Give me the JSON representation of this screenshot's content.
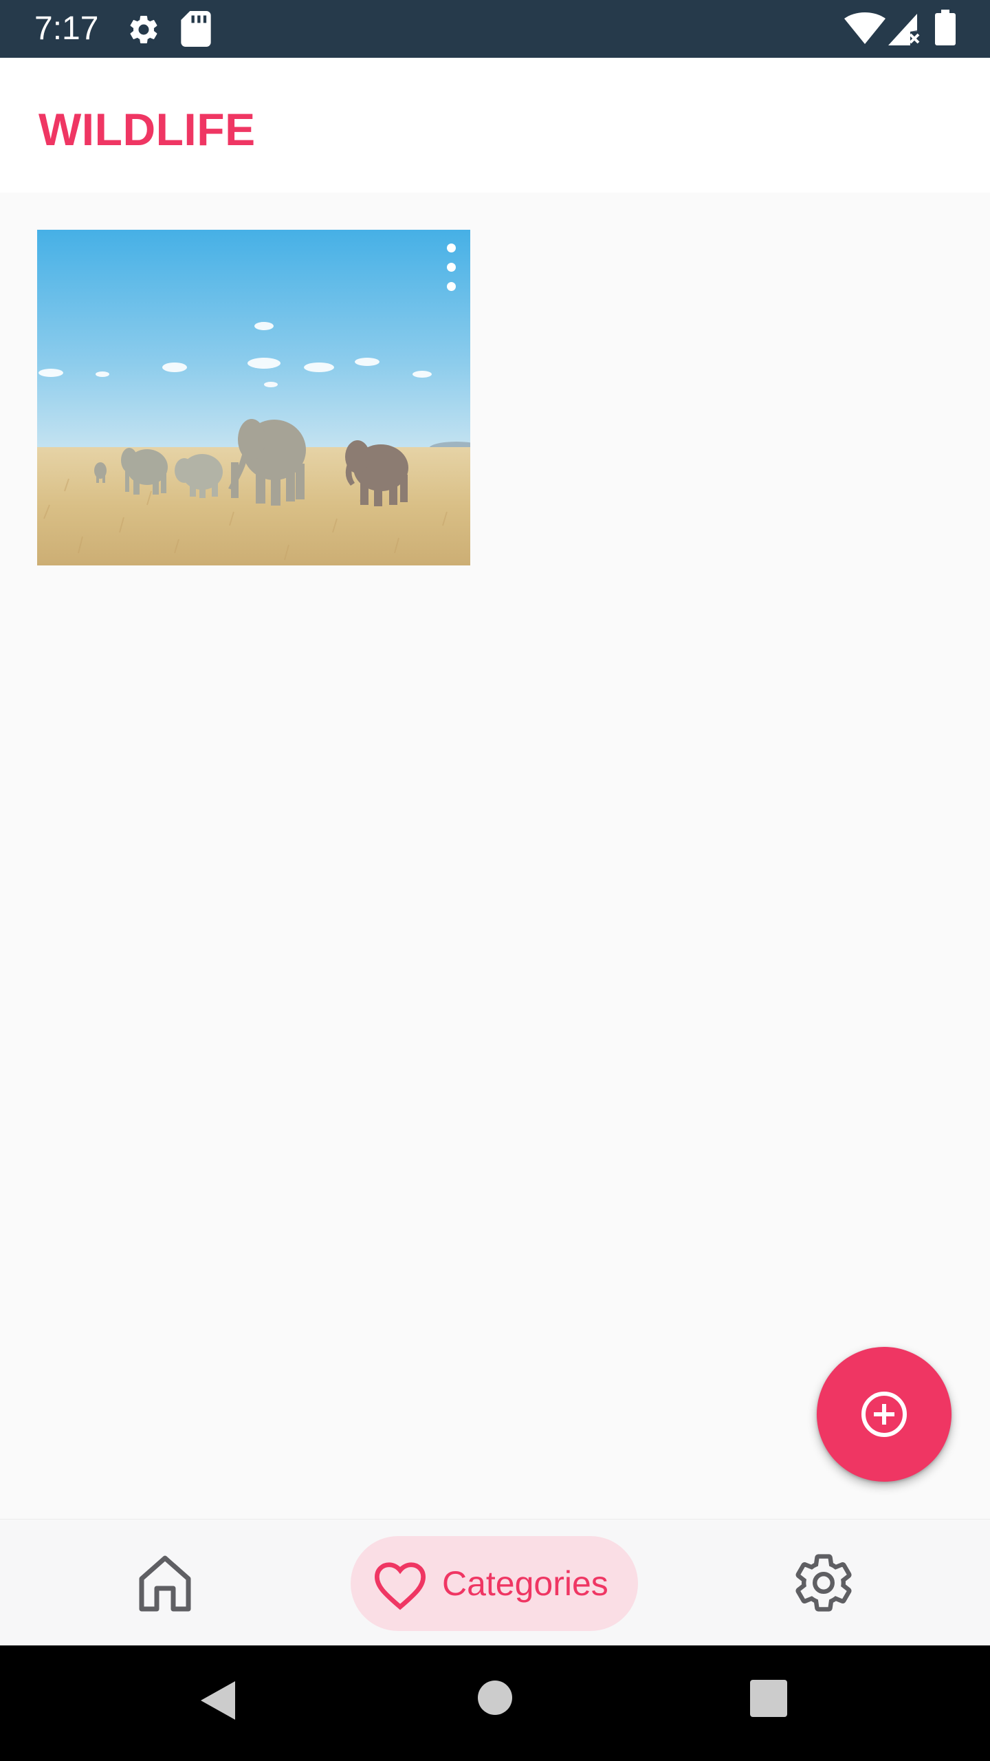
{
  "status_bar": {
    "time": "7:17",
    "left_icons": [
      "settings-icon",
      "sd-card-icon"
    ],
    "right_icons": [
      "wifi-icon",
      "cellular-signal-icon",
      "battery-icon"
    ]
  },
  "app_bar": {
    "title": "WILDLIFE"
  },
  "content": {
    "cards": [
      {
        "image": "elephants-savanna-photo",
        "menu_icon": "more-vert-icon"
      }
    ]
  },
  "fab": {
    "icon": "add-circle-icon"
  },
  "bottom_nav": {
    "items": [
      {
        "icon": "home-icon",
        "label": "",
        "selected": false
      },
      {
        "icon": "heart-icon",
        "label": "Categories",
        "selected": true
      },
      {
        "icon": "gear-icon",
        "label": "",
        "selected": false
      }
    ]
  },
  "system_nav": {
    "buttons": [
      "back-icon",
      "home-circle-icon",
      "recents-icon"
    ]
  },
  "colors": {
    "accent": "#ef3663",
    "status_bar": "#263a4b",
    "nav_selected_bg": "#fadee5",
    "background": "#fafafa"
  }
}
